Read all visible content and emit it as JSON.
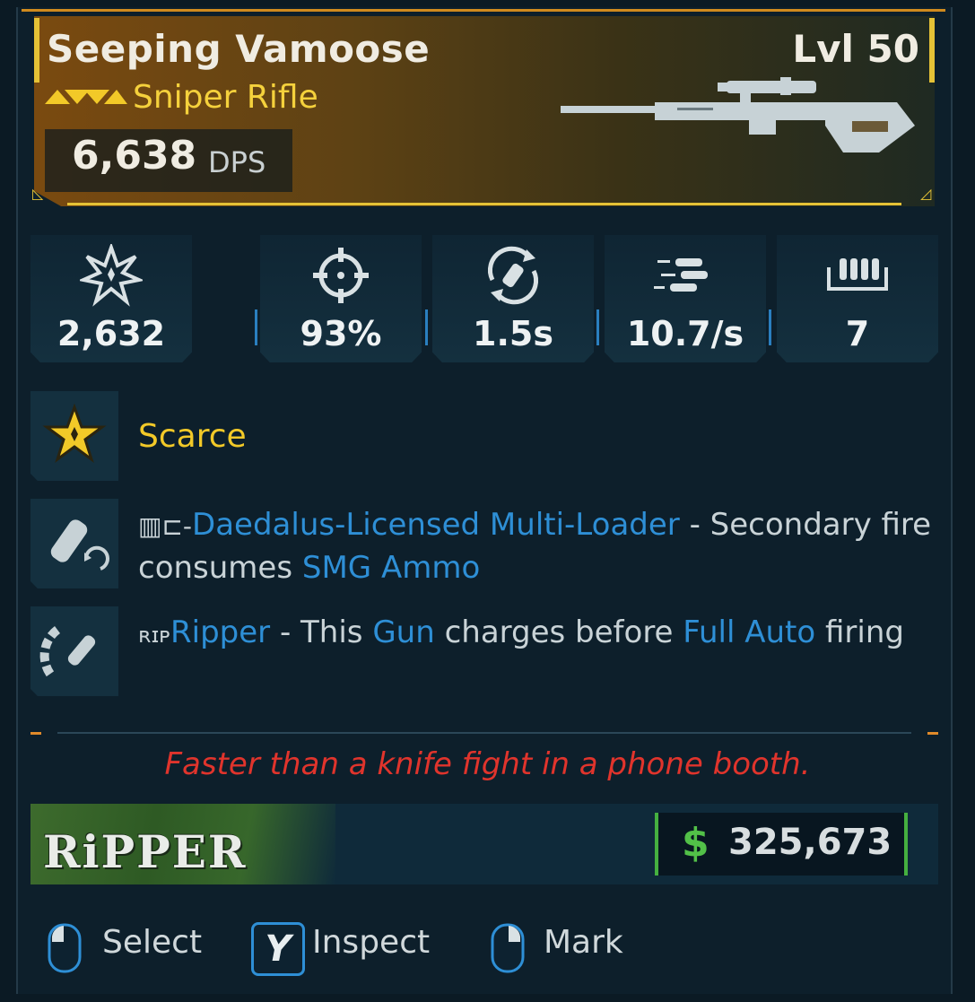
{
  "item": {
    "name": "Seeping Vamoose",
    "level": "Lvl 50",
    "type": "Sniper Rifle",
    "dps_value": "6,638",
    "dps_label": "DPS"
  },
  "stats": [
    {
      "icon": "damage-burst-icon",
      "value": "2,632"
    },
    {
      "icon": "crosshair-accuracy-icon",
      "value": "93%"
    },
    {
      "icon": "reload-time-icon",
      "value": "1.5s"
    },
    {
      "icon": "fire-rate-icon",
      "value": "10.7/s"
    },
    {
      "icon": "magazine-size-icon",
      "value": "7"
    }
  ],
  "rarity_perk": {
    "label": "Scarce",
    "icon": "scarce-star-icon"
  },
  "perks": [
    {
      "icon": "multi-loader-icon",
      "name": "Daedalus-Licensed Multi-Loader",
      "desc_part1": " - Secondary fire consumes ",
      "highlight": "SMG Ammo"
    },
    {
      "icon": "ripper-charge-icon",
      "name": "Ripper",
      "desc_part1": " - This ",
      "highlight1": "Gun",
      "desc_part2": " charges before ",
      "highlight2": "Full Auto",
      "desc_part3": " firing"
    }
  ],
  "flavor_text": "Faster than a knife fight in a phone booth.",
  "manufacturer": {
    "logo_text": "RiPPER"
  },
  "price": {
    "symbol": "$",
    "value": "325,673"
  },
  "actions": [
    {
      "icon": "mouse-left-icon",
      "label": "Select"
    },
    {
      "icon": "y-button-icon",
      "key": "Y",
      "label": "Inspect"
    },
    {
      "icon": "mouse-right-icon",
      "label": "Mark"
    }
  ],
  "colors": {
    "rarity": "#f2c928",
    "highlight": "#2e8fd6",
    "flavor": "#e0342c",
    "price": "#52c048"
  }
}
